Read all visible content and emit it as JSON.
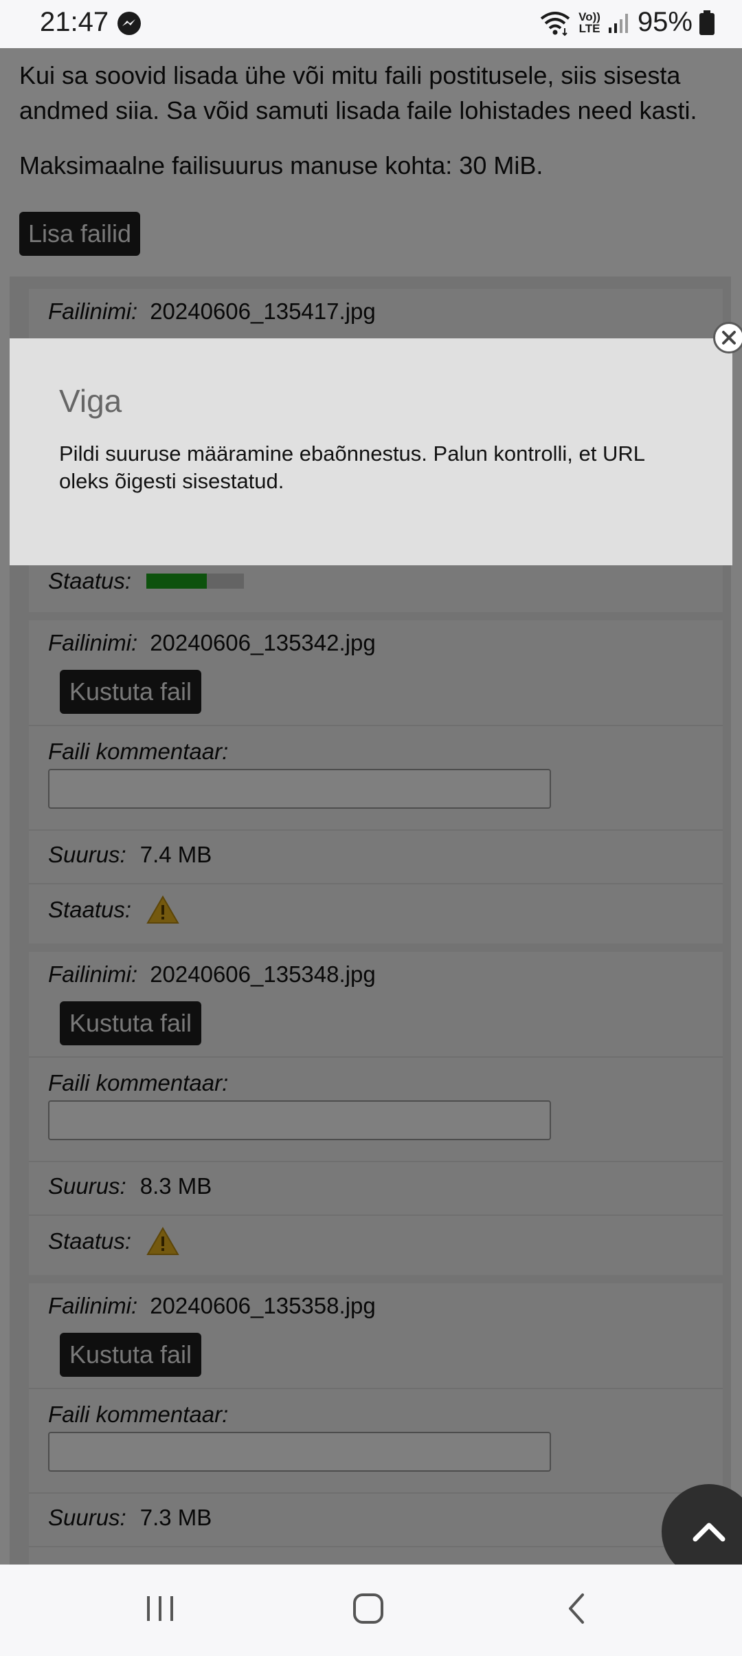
{
  "status_bar": {
    "time": "21:47",
    "notification_icon": "messenger-icon",
    "network_label_top": "Vo))",
    "network_label_bottom": "LTE",
    "battery": "95%"
  },
  "page": {
    "intro_text": "Kui sa soovid lisada ühe või mitu faili postitusele, siis sisesta andmed siia. Sa võid samuti lisada faile lohistades need kasti.",
    "max_size_text": "Maksimaalne failisuurus manuse kohta: 30 MiB.",
    "add_files_label": "Lisa failid"
  },
  "labels": {
    "filename": "Failinimi:",
    "delete": "Kustuta fail",
    "comment": "Faili kommentaar:",
    "size": "Suurus:",
    "status": "Staatus:"
  },
  "files": [
    {
      "name": "20240606_135417.jpg",
      "status": "uploading",
      "progress": 0.62
    },
    {
      "name": "20240606_135342.jpg",
      "size": "7.4 MB",
      "status": "warning"
    },
    {
      "name": "20240606_135348.jpg",
      "size": "8.3 MB",
      "status": "warning"
    },
    {
      "name": "20240606_135358.jpg",
      "size": "7.3 MB"
    }
  ],
  "dialog": {
    "title": "Viga",
    "message": "Pildi suuruse määramine ebaõnnestus. Palun kontrolli, et URL oleks õigesti sisestatud."
  },
  "colors": {
    "progress_fill": "#1aa51a",
    "button_bg": "#1f1f1f",
    "warning": "#e8b21e"
  }
}
